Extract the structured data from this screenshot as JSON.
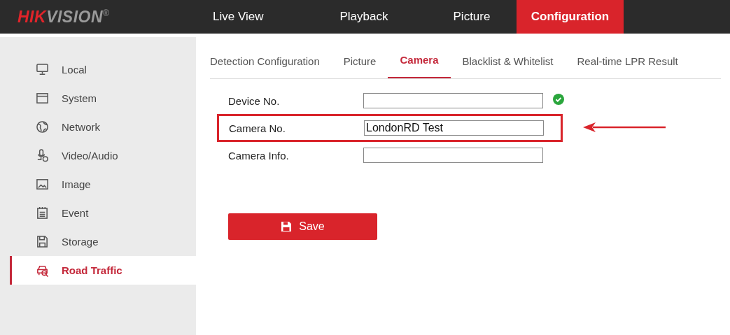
{
  "header": {
    "logo": {
      "part_a": "HIK",
      "part_b": "VISION",
      "mark": "®"
    },
    "nav": [
      {
        "label": "Live View",
        "selected": false
      },
      {
        "label": "Playback",
        "selected": false
      },
      {
        "label": "Picture",
        "selected": false
      },
      {
        "label": "Configuration",
        "selected": true
      }
    ]
  },
  "sidebar": {
    "items": [
      {
        "label": "Local",
        "kind": "monitor",
        "selected": false
      },
      {
        "label": "System",
        "kind": "window",
        "selected": false
      },
      {
        "label": "Network",
        "kind": "globe",
        "selected": false
      },
      {
        "label": "Video/Audio",
        "kind": "mic",
        "selected": false
      },
      {
        "label": "Image",
        "kind": "image",
        "selected": false
      },
      {
        "label": "Event",
        "kind": "calendar",
        "selected": false
      },
      {
        "label": "Storage",
        "kind": "disk",
        "selected": false
      },
      {
        "label": "Road Traffic",
        "kind": "car",
        "selected": true
      }
    ]
  },
  "tabs": [
    {
      "label": "Detection Configuration",
      "selected": false
    },
    {
      "label": "Picture",
      "selected": false
    },
    {
      "label": "Camera",
      "selected": true
    },
    {
      "label": "Blacklist & Whitelist",
      "selected": false
    },
    {
      "label": "Real-time LPR Result",
      "selected": false
    }
  ],
  "form": {
    "fields": [
      {
        "label": "Device No.",
        "valid": true,
        "highlighted": false
      },
      {
        "label": "Camera No.",
        "value": "LondonRD Test",
        "valid": false,
        "highlighted": true
      },
      {
        "label": "Camera Info.",
        "valid": false,
        "highlighted": false
      }
    ],
    "save_button": "Save"
  }
}
